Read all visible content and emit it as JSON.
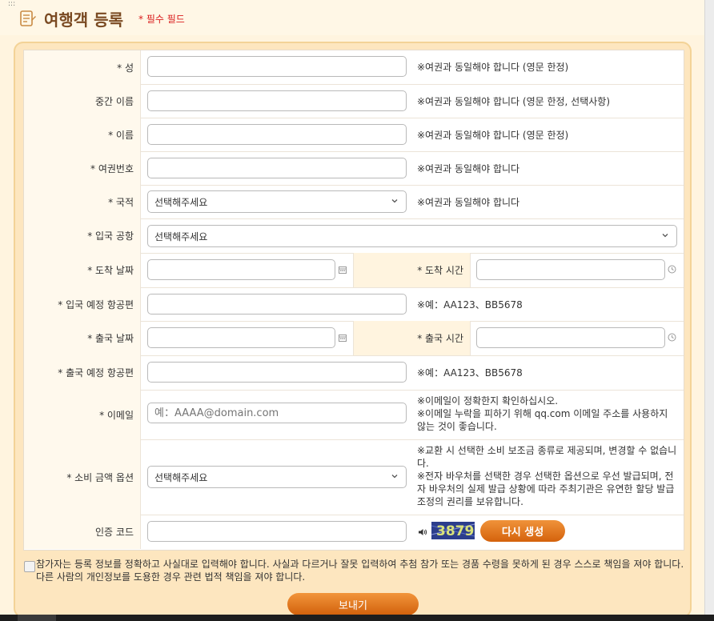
{
  "header": {
    "title": "여행객 등록",
    "required_note": "* 필수 필드"
  },
  "colors": {
    "accent": "#e0761c",
    "title": "#7a4a22",
    "required": "#d91c1c",
    "panel": "#fde6bf"
  },
  "form": {
    "surname": {
      "label": "* 성",
      "note": "※여권과 동일해야 합니다 (영문 한정)"
    },
    "middle_name": {
      "label": "중간 이름",
      "note": "※여권과 동일해야 합니다 (영문 한정, 선택사항)"
    },
    "given_name": {
      "label": "* 이름",
      "note": "※여권과 동일해야 합니다 (영문 한정)"
    },
    "passport": {
      "label": "* 여권번호",
      "note": "※여권과 동일해야 합니다"
    },
    "nationality": {
      "label": "* 국적",
      "value": "선택해주세요",
      "note": "※여권과 동일해야 합니다"
    },
    "entry_airport": {
      "label": "* 입국 공항",
      "value": "선택해주세요"
    },
    "arrival_date": {
      "label": "* 도착 날짜"
    },
    "arrival_time": {
      "label": "* 도착 시간"
    },
    "arrival_flight": {
      "label": "* 입국 예정 항공편",
      "note": "※예：AA123、BB5678"
    },
    "departure_date": {
      "label": "* 출국 날짜"
    },
    "departure_time": {
      "label": "* 출국 시간"
    },
    "departure_flight": {
      "label": "* 출국 예정 항공편",
      "note": "※예：AA123、BB5678"
    },
    "email": {
      "label": "* 이메일",
      "placeholder": "예：AAAA@domain.com",
      "note1": "※이메일이 정확한지 확인하십시오.",
      "note2": "※이메일 누락을 피하기 위해 qq.com 이메일 주소를 사용하지 않는 것이 좋습니다."
    },
    "subsidy": {
      "label": "* 소비 금액 옵션",
      "value": "선택해주세요",
      "note1": "※교환 시 선택한 소비 보조금 종류로 제공되며, 변경할 수 없습니다.",
      "note2": "※전자 바우처를 선택한 경우 선택한 옵션으로 우선 발급되며, 전자 바우처의 실제 발급 상황에 따라 주최기관은 유연한 할당 발급 조정의 권리를 보유합니다."
    },
    "captcha": {
      "label": "인증 코드",
      "code_image_text": "3879",
      "regen_label": "다시 생성"
    }
  },
  "agreement": "참가자는 등록 정보를 정확하고 사실대로 입력해야 합니다. 사실과 다르거나 잘못 입력하여 추첨 참가 또는 경품 수령을 못하게 된 경우 스스로 책임을 져야 합니다. 다른 사람의 개인정보를 도용한 경우 관련 법적 책임을 져야 합니다.",
  "submit_label": "보내기"
}
